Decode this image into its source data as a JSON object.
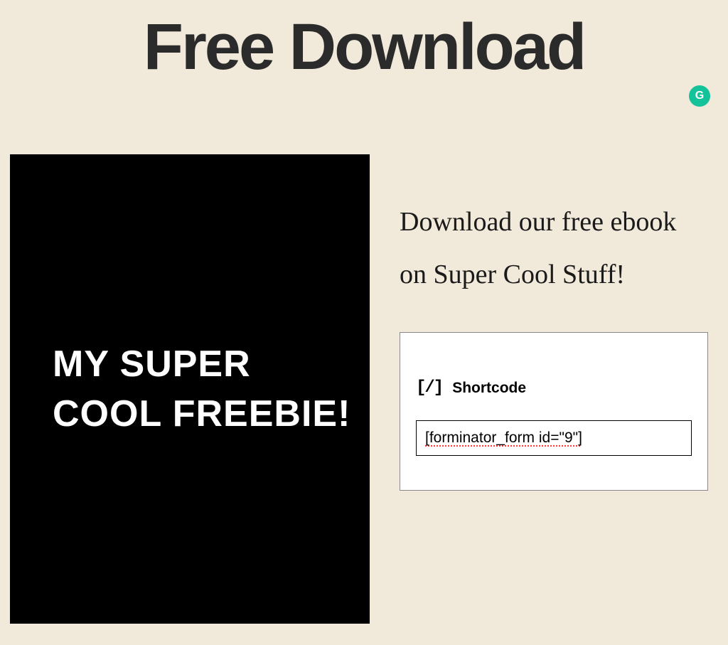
{
  "header": {
    "title": "Free Download"
  },
  "grammarly": {
    "label": "G"
  },
  "ebook": {
    "title_line1": "MY SUPER",
    "title_line2": "COOL FREEBIE!"
  },
  "content": {
    "description": "Download our free ebook on Super Cool Stuff!"
  },
  "shortcode": {
    "icon": "[/]",
    "label": "Shortcode",
    "value": "[forminator_form id=\"9\"]"
  }
}
